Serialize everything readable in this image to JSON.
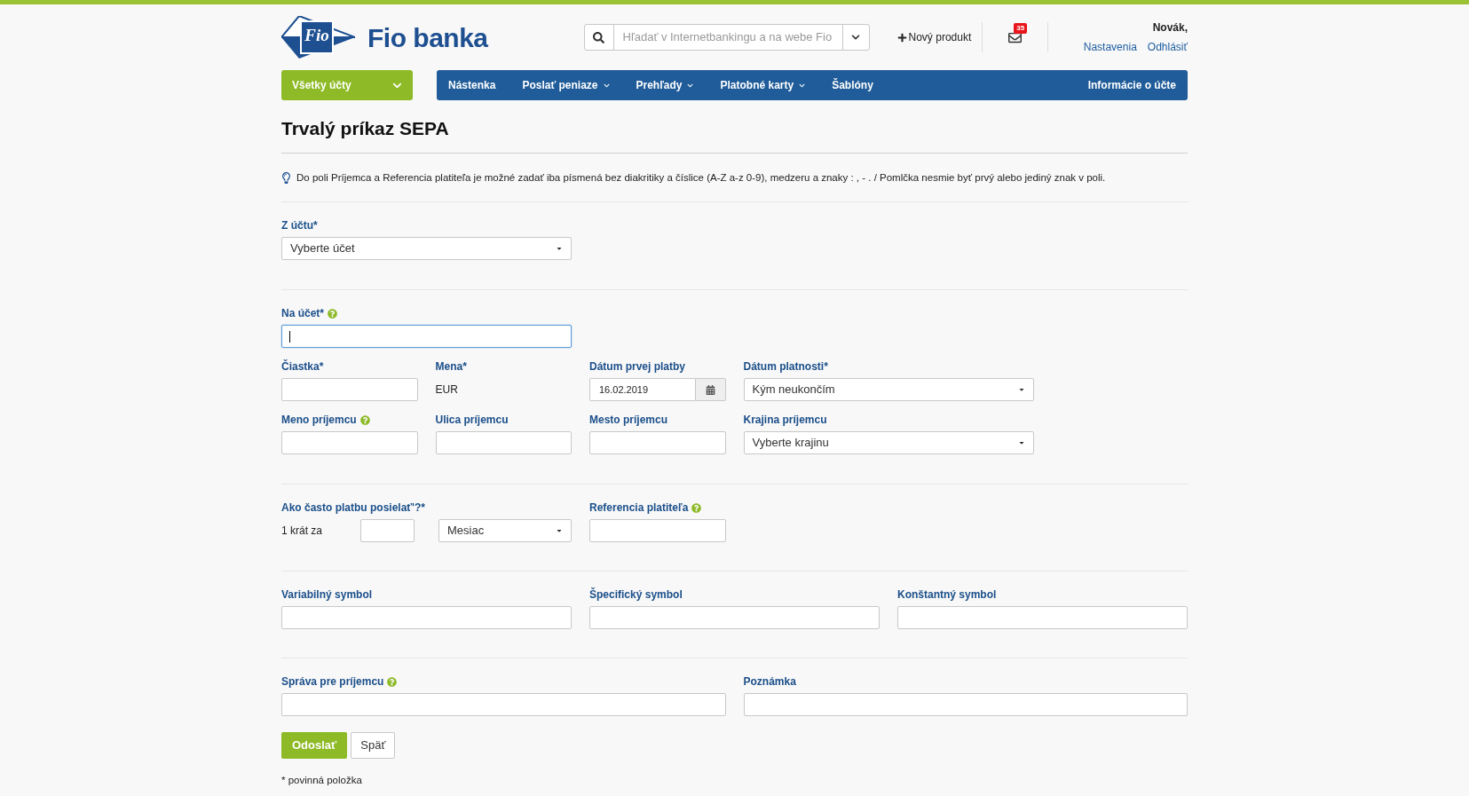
{
  "header": {
    "logo_mark": "Fio",
    "logo_text": "Fio banka",
    "search": {
      "placeholder": "Hľadať v Internetbankingu a na webe Fio"
    },
    "new_product": "Nový produkt",
    "mail_count": "35",
    "user_name": "Novák,",
    "user_links": [
      "Nastavenia",
      "Odhlásiť"
    ]
  },
  "nav": {
    "account_selector": "Všetky účty",
    "items": [
      {
        "label": "Nástenka",
        "dropdown": false
      },
      {
        "label": "Poslať peniaze",
        "dropdown": true
      },
      {
        "label": "Prehľady",
        "dropdown": true
      },
      {
        "label": "Platobné karty",
        "dropdown": true
      },
      {
        "label": "Šablóny",
        "dropdown": false
      }
    ],
    "right_item": "Informácie o účte"
  },
  "page_title": "Trvalý príkaz SEPA",
  "info": "Do poli Príjemca a Referencia platiteľa je možné zadať iba písmená bez diakritiky a číslice (A-Z a-z 0-9), medzeru a znaky : , - . / Pomlčka nesmie byť prvý alebo jediný znak v poli.",
  "sections": [
    {
      "rows": [
        [
          {
            "kind": "select",
            "label": "Z účtu*",
            "help": false,
            "value": "Vyberte účet"
          }
        ]
      ]
    },
    {
      "rows": [
        [
          {
            "kind": "input",
            "label": "Na účet*",
            "help": true,
            "focused": true
          }
        ],
        [
          {
            "kind": "input",
            "label": "Čiastka*",
            "help": false,
            "focused": false
          },
          {
            "kind": "text",
            "label": "Mena*",
            "help": false,
            "value": "EUR"
          },
          {
            "kind": "date",
            "label": "Dátum prvej platby",
            "help": false,
            "value": "16.02.2019"
          },
          {
            "kind": "select",
            "label": "Dátum platnosti*",
            "help": false,
            "value": "Kým neukončím"
          }
        ],
        [
          {
            "kind": "input",
            "label": "Meno príjemcu",
            "help": true,
            "focused": false
          },
          {
            "kind": "input",
            "label": "Ulica príjemcu",
            "help": false,
            "focused": false
          },
          {
            "kind": "input",
            "label": "Mesto príjemcu",
            "help": false,
            "focused": false
          },
          {
            "kind": "select",
            "label": "Krajina príjemcu",
            "help": false,
            "value": "Vyberte krajinu"
          }
        ]
      ]
    },
    {
      "rows": [
        [
          {
            "kind": "frequency",
            "label": "Ako často platbu posielať'?*",
            "help": false,
            "prefix": "1 krát za",
            "value": "Mesiac"
          },
          {
            "kind": "input",
            "label": "Referencia platiteľa",
            "help": true,
            "focused": false
          }
        ]
      ]
    },
    {
      "rows": [
        [
          {
            "kind": "input",
            "label": "Variabilný symbol",
            "help": false,
            "focused": false
          },
          {
            "kind": "input",
            "label": "Špecifický symbol",
            "help": false,
            "focused": false
          },
          {
            "kind": "input",
            "label": "Konštantný symbol",
            "help": false,
            "focused": false
          }
        ]
      ]
    },
    {
      "rows": [
        [
          {
            "kind": "input",
            "label": "Správa pre príjemcu",
            "help": true,
            "focused": false
          },
          {
            "kind": "input",
            "label": "Poznámka",
            "help": false,
            "focused": false
          }
        ]
      ]
    }
  ],
  "buttons": [
    {
      "label": "Odoslať",
      "kind": "primary"
    },
    {
      "label": "Späť",
      "kind": "secondary"
    }
  ],
  "footnote": "* povinná položka"
}
